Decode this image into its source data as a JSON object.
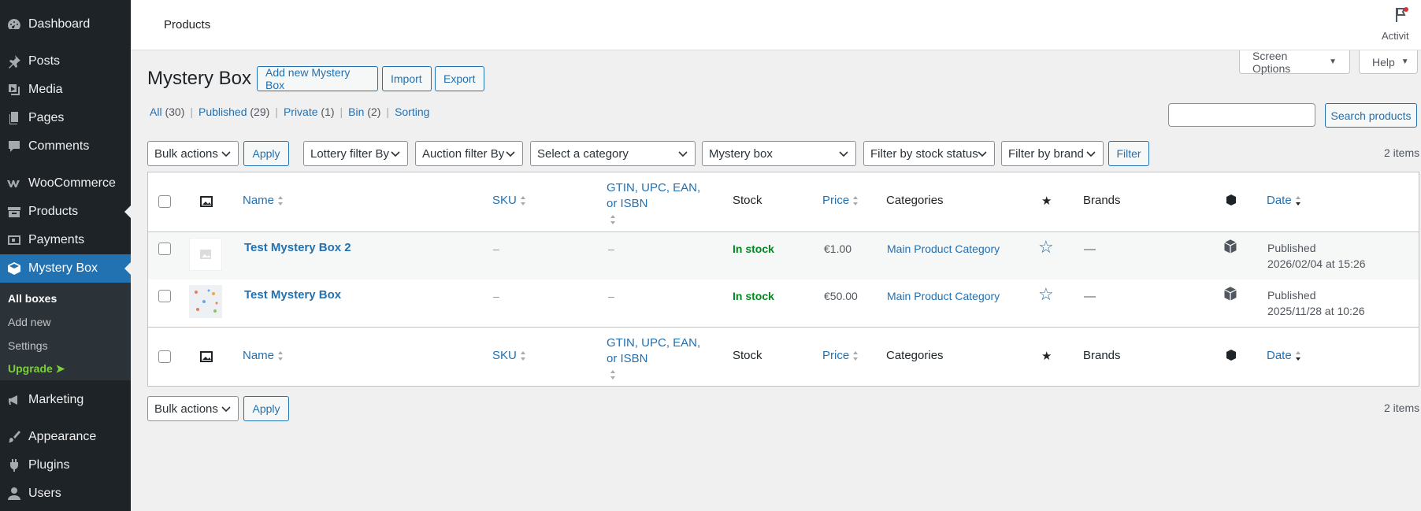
{
  "sidebar": {
    "items": [
      {
        "label": "Dashboard",
        "icon": "dashboard-icon"
      },
      {
        "label": "Posts",
        "icon": "pin-icon"
      },
      {
        "label": "Media",
        "icon": "media-icon"
      },
      {
        "label": "Pages",
        "icon": "pages-icon"
      },
      {
        "label": "Comments",
        "icon": "comment-icon"
      },
      {
        "label": "WooCommerce",
        "icon": "woo-icon"
      },
      {
        "label": "Products",
        "icon": "archive-icon"
      },
      {
        "label": "Payments",
        "icon": "payments-icon"
      },
      {
        "label": "Mystery Box",
        "icon": "mystery-box-icon"
      },
      {
        "label": "Marketing",
        "icon": "megaphone-icon"
      },
      {
        "label": "Appearance",
        "icon": "brush-icon"
      },
      {
        "label": "Plugins",
        "icon": "plugin-icon"
      },
      {
        "label": "Users",
        "icon": "user-icon"
      }
    ],
    "submenu": [
      {
        "label": "All boxes"
      },
      {
        "label": "Add new"
      },
      {
        "label": "Settings"
      },
      {
        "label": "Upgrade ➤"
      }
    ]
  },
  "topbar": {
    "title": "Products",
    "activity_label": "Activit"
  },
  "screen_options": {
    "label": "Screen Options",
    "help_label": "Help"
  },
  "page": {
    "heading": "Mystery Box",
    "actions": [
      "Add new Mystery Box",
      "Import",
      "Export"
    ]
  },
  "views": [
    {
      "label": "All",
      "count": "(30)"
    },
    {
      "label": "Published",
      "count": "(29)"
    },
    {
      "label": "Private",
      "count": "(1)"
    },
    {
      "label": "Bin",
      "count": "(2)"
    },
    {
      "label": "Sorting",
      "count": ""
    }
  ],
  "search": {
    "placeholder": "",
    "button": "Search products"
  },
  "filters": {
    "bulk_actions": "Bulk actions",
    "apply": "Apply",
    "lottery": "Lottery filter By",
    "auction": "Auction filter By",
    "category": "Select a category",
    "product_type": "Mystery box",
    "stock_status": "Filter by stock status",
    "brand": "Filter by brand",
    "filter_button": "Filter",
    "items_count": "2 items"
  },
  "table": {
    "columns": {
      "name": "Name",
      "sku": "SKU",
      "gtin": "GTIN, UPC, EAN, or ISBN",
      "stock": "Stock",
      "price": "Price",
      "categories": "Categories",
      "brands": "Brands",
      "date": "Date"
    },
    "rows": [
      {
        "name": "Test Mystery Box 2",
        "sku": "–",
        "gtin": "–",
        "stock": "In stock",
        "price": "€1.00",
        "category": "Main Product Category",
        "brands": "—",
        "date_status": "Published",
        "date": "2026/02/04 at 15:26"
      },
      {
        "name": "Test Mystery Box",
        "sku": "–",
        "gtin": "–",
        "stock": "In stock",
        "price": "€50.00",
        "category": "Main Product Category",
        "brands": "—",
        "date_status": "Published",
        "date": "2025/11/28 at 10:26"
      }
    ]
  },
  "bottom": {
    "bulk_actions": "Bulk actions",
    "apply": "Apply",
    "items_count": "2 items"
  },
  "colors": {
    "sidebar_bg": "#1d2327",
    "accent": "#2271b1",
    "in_stock": "#008a20",
    "upgrade": "#7ad03a"
  }
}
